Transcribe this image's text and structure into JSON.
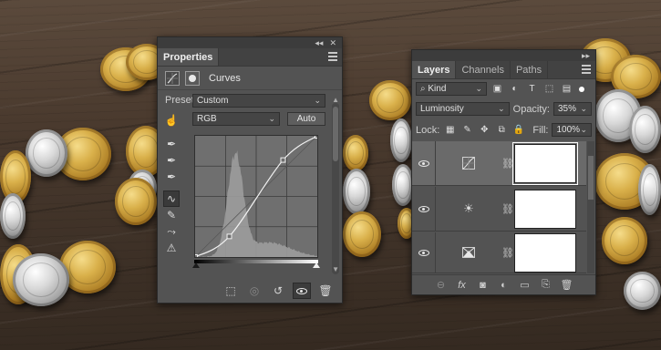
{
  "properties": {
    "tab": "Properties",
    "panel_header": "Curves",
    "preset_label": "Preset:",
    "preset_value": "Custom",
    "channel_value": "RGB",
    "auto_label": "Auto",
    "curve_points": [
      [
        0.0,
        0.0
      ],
      [
        0.28,
        0.17
      ],
      [
        0.72,
        0.8
      ],
      [
        1.0,
        1.0
      ]
    ]
  },
  "layers": {
    "tabs": [
      "Layers",
      "Channels",
      "Paths"
    ],
    "filter_kind": "Kind",
    "blend_mode": "Luminosity",
    "opacity_label": "Opacity:",
    "opacity_value": "35%",
    "lock_label": "Lock:",
    "fill_label": "Fill:",
    "fill_value": "100%",
    "items": [
      {
        "type": "curves-adjustment",
        "visible": true,
        "selected": true
      },
      {
        "type": "brightness-adjustment",
        "visible": true,
        "selected": false
      },
      {
        "type": "levels-adjustment",
        "visible": true,
        "selected": false
      }
    ]
  },
  "colors": {
    "panel_bg": "#535353",
    "panel_header_bg": "#424242",
    "selected_layer_bg": "#6a6a6a"
  }
}
